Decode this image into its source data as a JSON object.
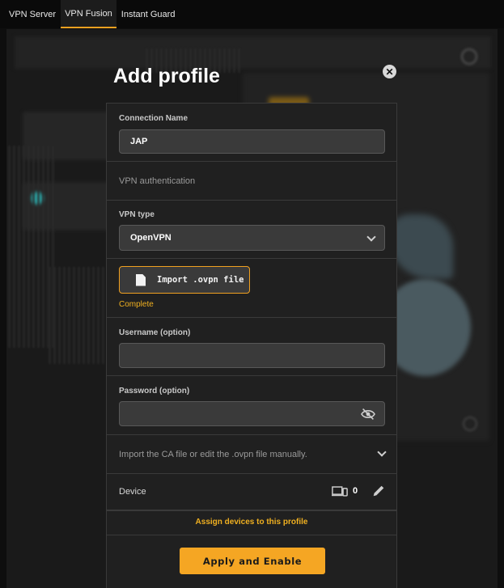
{
  "topnav": {
    "tabs": [
      {
        "label": "VPN Server",
        "active": false
      },
      {
        "label": "VPN Fusion",
        "active": true
      },
      {
        "label": "Instant Guard",
        "active": false
      }
    ]
  },
  "modal": {
    "title": "Add profile",
    "close_icon": "close-icon",
    "connection_name": {
      "label": "Connection Name",
      "value": "JAP"
    },
    "vpn_authentication": {
      "label": "VPN authentication"
    },
    "vpn_type": {
      "label": "VPN type",
      "selected": "OpenVPN"
    },
    "import": {
      "button_label": "Import .ovpn file",
      "status": "Complete"
    },
    "username": {
      "label": "Username (option)",
      "value": ""
    },
    "password": {
      "label": "Password (option)",
      "value": ""
    },
    "ca_file": {
      "label": "Import the CA file or edit the .ovpn file manually."
    },
    "device": {
      "label": "Device",
      "count": "0"
    },
    "assign_link": "Assign devices to this profile",
    "apply_button": "Apply and Enable"
  },
  "colors": {
    "accent": "#f5a623",
    "background": "#0e0e0e",
    "modal": "#202020",
    "field": "#3a3a3a"
  }
}
